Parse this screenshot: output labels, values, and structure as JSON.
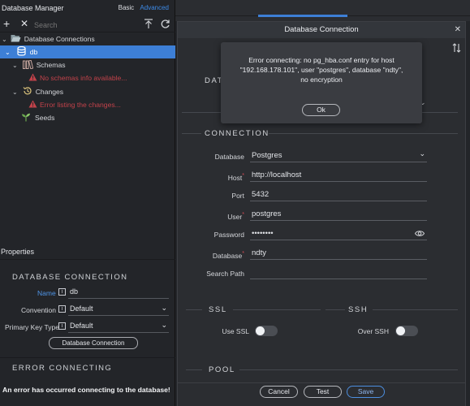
{
  "left_panel": {
    "title": "Database Manager",
    "mode_basic": "Basic",
    "mode_advanced": "Advanced",
    "search_placeholder": "Search",
    "tree": {
      "root": "Database Connections",
      "db": "db",
      "schemas": "Schemas",
      "schemas_error": "No schemas info available...",
      "changes": "Changes",
      "changes_error": "Error listing the changes...",
      "seeds": "Seeds"
    },
    "properties": {
      "header": "Properties",
      "section_connection": "DATABASE CONNECTION",
      "name_label": "Name",
      "name_value": "db",
      "convention_label": "Convention",
      "convention_value": "Default",
      "pk_label": "Primary Key Type",
      "pk_value": "Default",
      "db_conn_button": "Database Connection",
      "section_error": "ERROR CONNECTING",
      "error_message": "An error has occurred connecting to the database!"
    }
  },
  "dialog": {
    "title": "Database Connection",
    "section_database": "DAT",
    "section_connection": "CONNECTION",
    "fields": {
      "database_label": "Database",
      "database_value": "Postgres",
      "host_label": "Host",
      "host_value": "http://localhost",
      "port_label": "Port",
      "port_value": "5432",
      "user_label": "User",
      "user_value": "postgres",
      "password_label": "Password",
      "password_value": "••••••••",
      "dbname_label": "Database",
      "dbname_value": "ndty",
      "searchpath_label": "Search Path",
      "searchpath_value": ""
    },
    "ssl": {
      "section": "SSL",
      "label": "Use SSL",
      "on": false
    },
    "ssh": {
      "section": "SSH",
      "label": "Over SSH",
      "on": false
    },
    "section_pool": "POOL",
    "buttons": {
      "cancel": "Cancel",
      "test": "Test",
      "save": "Save"
    }
  },
  "alert": {
    "message": "Error connecting: no pg_hba.conf entry for host \"192.168.178.101\", user \"postgres\", database \"ndty\", no encryption",
    "ok": "Ok"
  },
  "colors": {
    "accent": "#3d7fd6",
    "error": "#c2424a",
    "panel_bg": "#232529",
    "dialog_bg": "#2b2d31"
  }
}
